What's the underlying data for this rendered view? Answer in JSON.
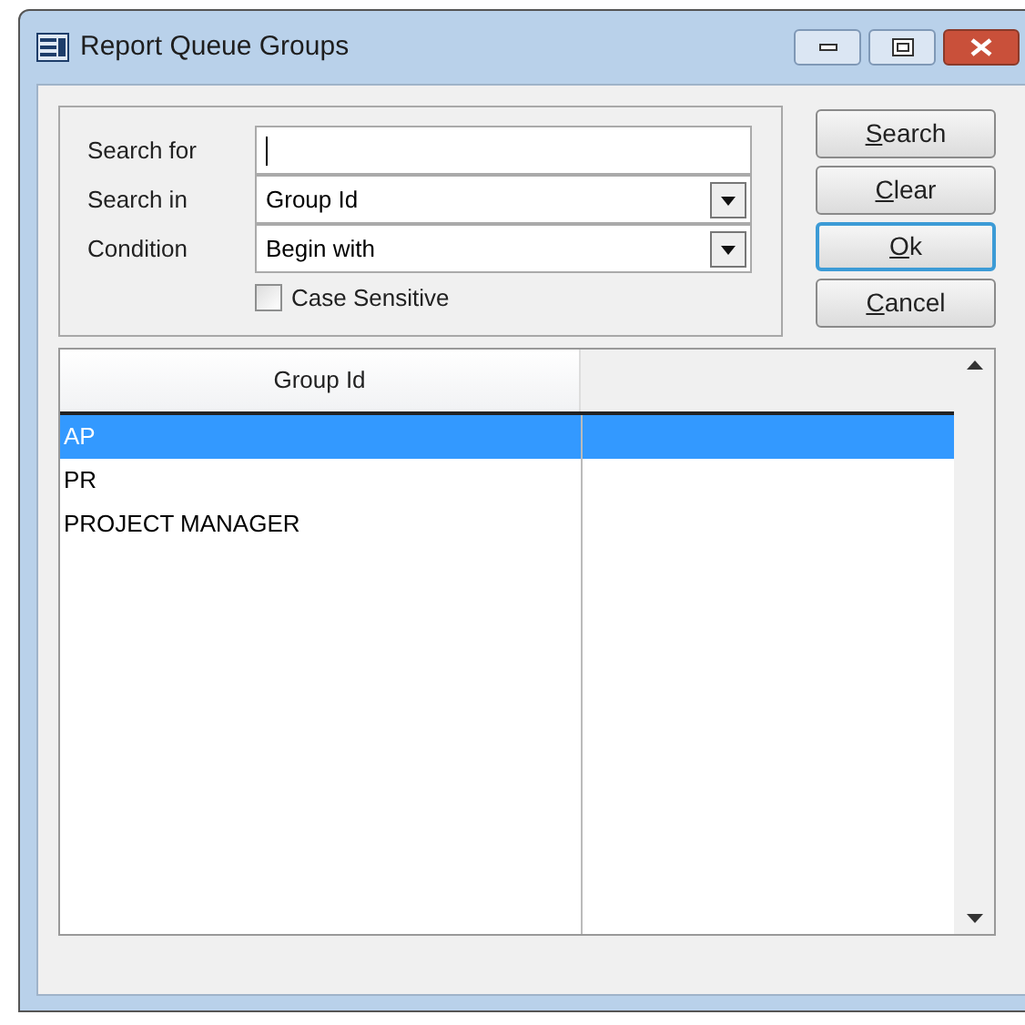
{
  "window": {
    "title": "Report Queue Groups"
  },
  "search_form": {
    "fields": [
      {
        "kind": "text",
        "label": "Search for"
      },
      {
        "kind": "dropdown",
        "label": "Search in",
        "value": "Group Id"
      },
      {
        "kind": "dropdown",
        "label": "Condition",
        "value": "Begin with"
      }
    ],
    "case_sensitive": {
      "label": "Case Sensitive",
      "checked": false
    }
  },
  "buttons": [
    {
      "label": "Search",
      "focused": false
    },
    {
      "label": "Clear",
      "focused": false
    },
    {
      "label": "Ok",
      "focused": true
    },
    {
      "label": "Cancel",
      "focused": false
    }
  ],
  "table": {
    "columns": [
      "Group Id"
    ],
    "rows": [
      {
        "cells": [
          "AP"
        ],
        "selected": true
      },
      {
        "cells": [
          "PR"
        ],
        "selected": false
      },
      {
        "cells": [
          "PROJECT MANAGER"
        ],
        "selected": false
      }
    ]
  }
}
